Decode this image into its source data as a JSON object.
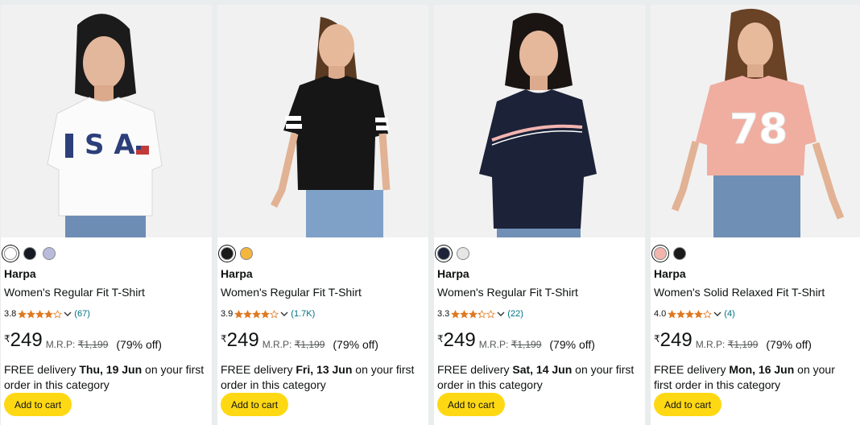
{
  "colors": {
    "star": "#de7921",
    "button": "#ffd814",
    "link": "#007185"
  },
  "products": [
    {
      "image_icon": "tshirt-white-usa-model",
      "swatches": [
        "#ffffff",
        "#161a25",
        "#b9badc"
      ],
      "brand": "Harpa",
      "title": "Women's Regular Fit T-Shirt",
      "rating": "3.8",
      "rating_value": 3.8,
      "reviews": "(67)",
      "currency": "₹",
      "price": "249",
      "mrp_label": "M.R.P:",
      "mrp": "₹1,199",
      "discount": "(79% off)",
      "delivery_prefix": "FREE delivery ",
      "delivery_date": "Thu, 19 Jun",
      "delivery_suffix": " on your first order in this category",
      "cta": "Add to cart"
    },
    {
      "image_icon": "tshirt-black-stripes-model",
      "swatches": [
        "#1a1a1a",
        "#f4b63d"
      ],
      "brand": "Harpa",
      "title": "Women's Regular Fit T-Shirt",
      "rating": "3.9",
      "rating_value": 3.9,
      "reviews": "(1.7K)",
      "currency": "₹",
      "price": "249",
      "mrp_label": "M.R.P:",
      "mrp": "₹1,199",
      "discount": "(79% off)",
      "delivery_prefix": "FREE delivery ",
      "delivery_date": "Fri, 13 Jun",
      "delivery_suffix": " on your first order in this category",
      "cta": "Add to cart"
    },
    {
      "image_icon": "tshirt-navy-stripe-model",
      "swatches": [
        "#1d2339",
        "#e6e6e6"
      ],
      "brand": "Harpa",
      "title": "Women's Regular Fit T-Shirt",
      "rating": "3.3",
      "rating_value": 3.3,
      "reviews": "(22)",
      "currency": "₹",
      "price": "249",
      "mrp_label": "M.R.P:",
      "mrp": "₹1,199",
      "discount": "(79% off)",
      "delivery_prefix": "FREE delivery ",
      "delivery_date": "Sat, 14 Jun",
      "delivery_suffix": " on your first order in this category",
      "cta": "Add to cart"
    },
    {
      "image_icon": "tshirt-peach-78-model",
      "swatches": [
        "#f2b5ad",
        "#1a1a1a"
      ],
      "brand": "Harpa",
      "title": "Women's Solid Relaxed Fit T-Shirt",
      "rating": "4.0",
      "rating_value": 4.0,
      "reviews": "(4)",
      "currency": "₹",
      "price": "249",
      "mrp_label": "M.R.P:",
      "mrp": "₹1,199",
      "discount": "(79% off)",
      "delivery_prefix": "FREE delivery ",
      "delivery_date": "Mon, 16 Jun",
      "delivery_suffix": " on your first order in this category",
      "cta": "Add to cart"
    }
  ]
}
